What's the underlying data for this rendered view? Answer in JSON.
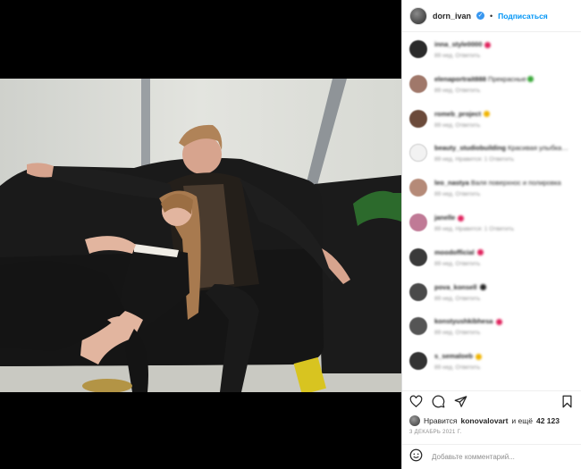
{
  "post": {
    "username": "dorn_ivan",
    "verified_mark": "✓",
    "separator": "•",
    "follow_label": "Подписаться"
  },
  "comments": [
    {
      "user": "inna_style0000",
      "text": "",
      "time": "89 нед.",
      "reply": "Ответить",
      "avatar_color": "#2b2b2b",
      "emoji_color": "#e0245e"
    },
    {
      "user": "elenaportrait888",
      "text": "Прекрасные",
      "time": "89 нед.",
      "reply": "Ответить",
      "avatar_color": "#a0786a",
      "emoji_color": "#3aa83a"
    },
    {
      "user": "romeb_project",
      "text": "",
      "time": "89 нед.",
      "reply": "Ответить",
      "avatar_color": "#6b4a3a",
      "emoji_color": "#f0b400"
    },
    {
      "user": "beauty_studiobuilding",
      "text": "Красивая улыбка…",
      "time": "89 нед.",
      "reply": "Нравится: 1 Ответить",
      "avatar_color": "#f2f2f2",
      "emoji_color": ""
    },
    {
      "user": "leo_nastya",
      "text": "Валя поверхнос и полировка",
      "time": "89 нед.",
      "reply": "Ответить",
      "avatar_color": "#b58a78",
      "emoji_color": ""
    },
    {
      "user": "janelle",
      "text": "",
      "time": "89 нед.",
      "reply": "Нравится: 1 Ответить",
      "avatar_color": "#c07a96",
      "emoji_color": "#e0245e"
    },
    {
      "user": "moodofficial",
      "text": "",
      "time": "89 нед.",
      "reply": "Ответить",
      "avatar_color": "#3a3a3a",
      "emoji_color": "#e0245e"
    },
    {
      "user": "pova_konsell",
      "text": "",
      "time": "89 нед.",
      "reply": "Ответить",
      "avatar_color": "#4a4a4a",
      "emoji_color": "#262626"
    },
    {
      "user": "konstyushkibhesa",
      "text": "",
      "time": "89 нед.",
      "reply": "Ответить",
      "avatar_color": "#555555",
      "emoji_color": "#e0245e"
    },
    {
      "user": "s_semaloeb",
      "text": "",
      "time": "89 нед.",
      "reply": "Ответить",
      "avatar_color": "#333333",
      "emoji_color": "#f0b400"
    }
  ],
  "likes": {
    "prefix": "Нравится",
    "user": "konovalovart",
    "suffix": "и ещё",
    "count": "42 123"
  },
  "date": "3 ДЕКАБРЬ 2021 Г.",
  "add_comment": {
    "placeholder": "Добавьте комментарий..."
  },
  "icons": {
    "like": "heart-icon",
    "comment": "comment-icon",
    "share": "send-icon",
    "save": "bookmark-icon",
    "emoji": "smiley-icon"
  }
}
